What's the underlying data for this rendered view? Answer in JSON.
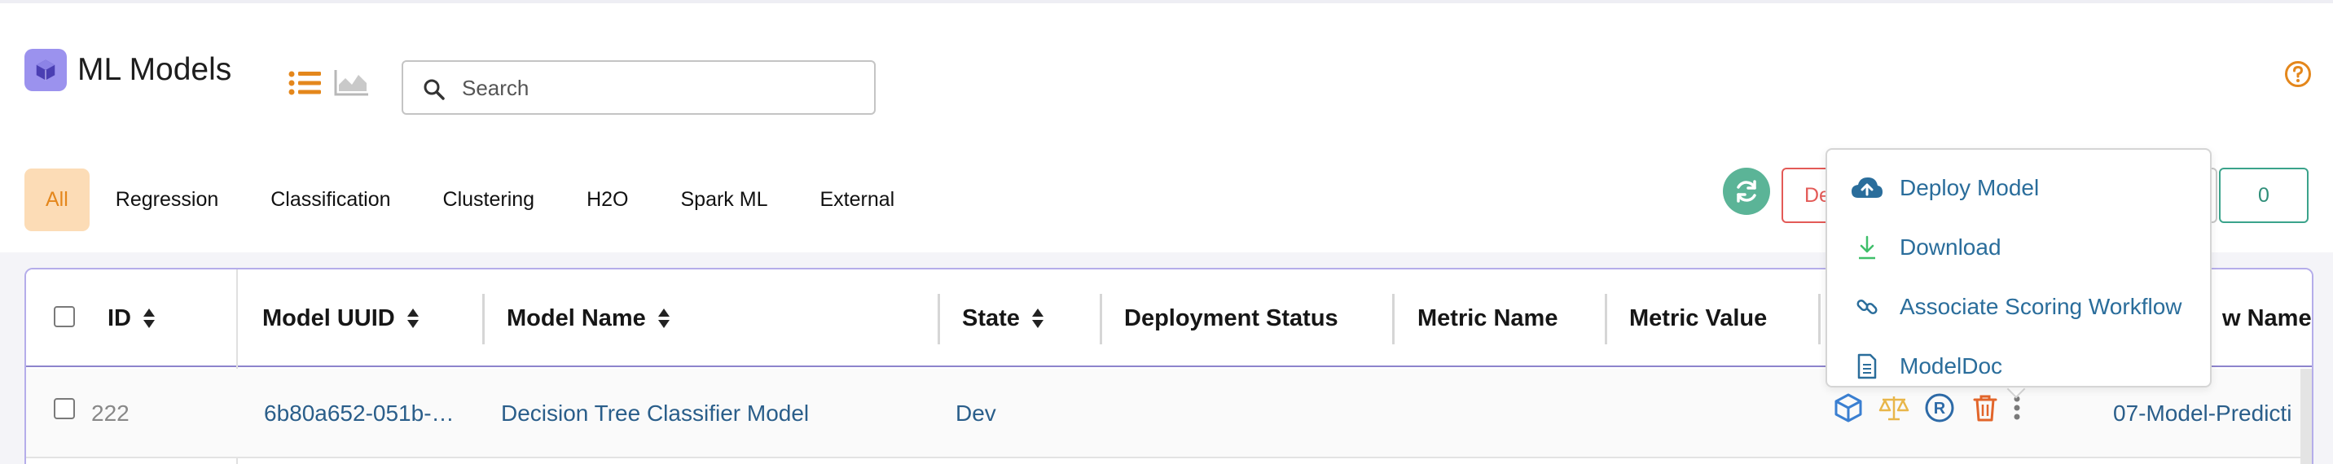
{
  "header": {
    "title": "ML Models",
    "search_placeholder": "Search"
  },
  "tabs": [
    {
      "label": "All",
      "active": true
    },
    {
      "label": "Regression"
    },
    {
      "label": "Classification"
    },
    {
      "label": "Clustering"
    },
    {
      "label": "H2O"
    },
    {
      "label": "Spark ML"
    },
    {
      "label": "External"
    }
  ],
  "toolbar": {
    "delete_label_partial": "De",
    "count_label": "0"
  },
  "table": {
    "columns": [
      "ID",
      "Model UUID",
      "Model Name",
      "State",
      "Deployment Status",
      "Metric Name",
      "Metric Value",
      "w Name"
    ],
    "rows": [
      {
        "id": "222",
        "uuid": "6b80a652-051b-…",
        "name": "Decision Tree Classifier Model",
        "state": "Dev",
        "deployment_status": "",
        "metric_name": "",
        "metric_value": "",
        "workflow_name": "07-Model-Predicti"
      }
    ]
  },
  "dropdown": {
    "items": [
      {
        "label": "Deploy Model",
        "icon": "cloud-upload-icon"
      },
      {
        "label": "Download",
        "icon": "download-icon"
      },
      {
        "label": "Associate Scoring Workflow",
        "icon": "link-icon"
      },
      {
        "label": "ModelDoc",
        "icon": "document-icon"
      }
    ]
  },
  "colors": {
    "accent_orange": "#e4871c",
    "active_tab_bg": "#fcdcb6",
    "link_blue": "#2a6d9b",
    "refresh_green": "#5bb497",
    "delete_red": "#e35a57",
    "table_border": "#b5adea"
  }
}
